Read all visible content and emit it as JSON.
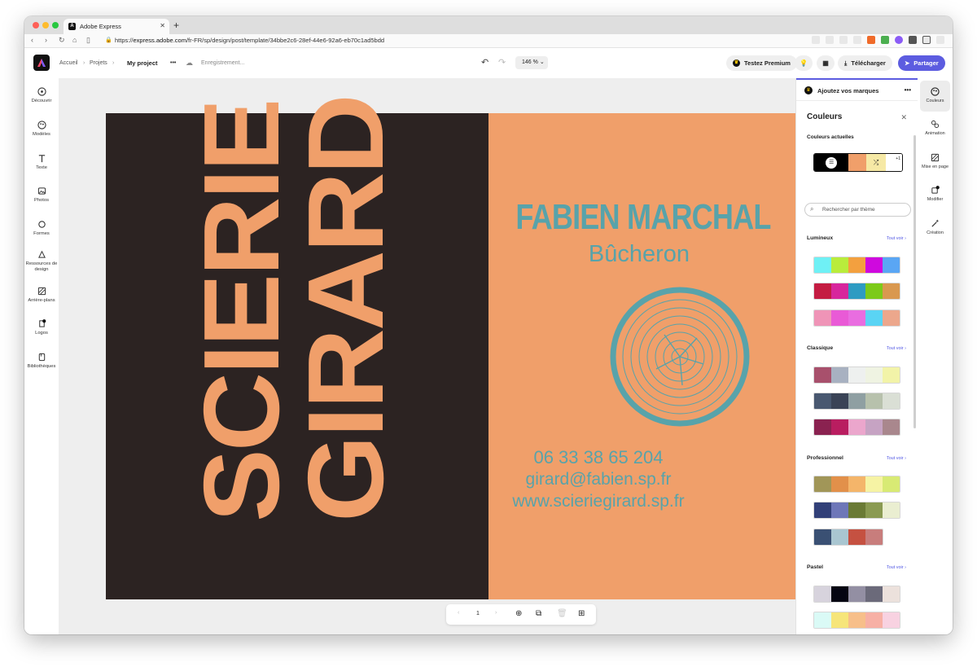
{
  "browser": {
    "tab_title": "Adobe Express",
    "url_prefix": "https://",
    "url_host": "express.adobe.com",
    "url_path": "/fr-FR/sp/design/post/template/34bbe2c6-28ef-44e6-92a6-eb70c1ad5bdd"
  },
  "header": {
    "breadcrumb_home": "Accueil",
    "breadcrumb_projects": "Projets",
    "project_name": "My project",
    "more": "•••",
    "save_status": "Enregistrement...",
    "zoom": "146 %",
    "premium_label": "Testez Premium",
    "download_label": "Télécharger",
    "share_label": "Partager"
  },
  "left_rail": [
    {
      "label": "Découvrir",
      "icon": "compass-icon"
    },
    {
      "label": "Modèles",
      "icon": "templates-icon"
    },
    {
      "label": "Texte",
      "icon": "text-icon"
    },
    {
      "label": "Photos",
      "icon": "photo-icon"
    },
    {
      "label": "Formes",
      "icon": "shapes-icon"
    },
    {
      "label": "Ressources de design",
      "icon": "design-assets-icon"
    },
    {
      "label": "Arrière-plans",
      "icon": "background-icon"
    },
    {
      "label": "Logos",
      "icon": "logo-icon"
    },
    {
      "label": "Bibliothèques",
      "icon": "library-icon"
    }
  ],
  "card": {
    "brand_line1": "SCIERIE",
    "brand_line2": "GIRARD",
    "name": "FABIEN MARCHAL",
    "job": "Bûcheron",
    "phone": "06 33 38 65 204",
    "email": "girard@fabien.sp.fr",
    "website": "www.scieriegirard.sp.fr",
    "colors": {
      "dark": "#2c2322",
      "orange": "#f09f6a",
      "teal": "#58a3aa"
    }
  },
  "pager": {
    "page": "1"
  },
  "panel": {
    "brand_header": "Ajoutez vos marques",
    "title": "Couleurs",
    "current_label": "Couleurs actuelles",
    "current_colors": [
      "#000000",
      "#f09f6a",
      "#f6e9a5"
    ],
    "current_extra": "+1",
    "search_placeholder": "Rechercher par thème",
    "see_all": "Tout voir",
    "themes": [
      {
        "name": "Lumineux",
        "palettes": [
          [
            "#6ff0f5",
            "#b9ec3c",
            "#f3a03f",
            "#cf09de",
            "#5aa6f4"
          ],
          [
            "#c41c42",
            "#d7259c",
            "#2e9bc2",
            "#7cca19",
            "#d9984f"
          ],
          [
            "#ef94b7",
            "#e95ad6",
            "#e96de0",
            "#5ad4f4",
            "#eca78c"
          ]
        ]
      },
      {
        "name": "Classique",
        "palettes": [
          [
            "#a8506c",
            "#a8b1c1",
            "#eef0ef",
            "#eff3e2",
            "#f2f3a8"
          ],
          [
            "#495870",
            "#3a4356",
            "#8f9fa2",
            "#b7c1ac",
            "#dadfd5"
          ],
          [
            "#8a2250",
            "#b91d60",
            "#eba6cc",
            "#c6a3c3",
            "#a9878d"
          ]
        ]
      },
      {
        "name": "Professionnel",
        "palettes": [
          [
            "#a19658",
            "#e2904a",
            "#f4b56a",
            "#f6f3a4",
            "#d8ea74"
          ],
          [
            "#324078",
            "#6e77b8",
            "#6a7a35",
            "#8a9a52",
            "#eaeed1"
          ],
          [
            "#3a5073",
            "#a9c6d1",
            "#c55141",
            "#c87d7c"
          ]
        ]
      },
      {
        "name": "Pastel",
        "palettes": [
          [
            "#d7d3dd",
            "#050512",
            "#938fa3",
            "#6b6a7a",
            "#ece1dc"
          ],
          [
            "#dafaf6",
            "#f6e57a",
            "#f7bf8a",
            "#f7b0a5",
            "#f8d2e1"
          ]
        ]
      }
    ]
  },
  "right_rail": [
    {
      "label": "Couleurs",
      "icon": "palette-icon"
    },
    {
      "label": "Animation",
      "icon": "animation-icon"
    },
    {
      "label": "Mise en page",
      "icon": "layout-icon"
    },
    {
      "label": "Modifier",
      "icon": "edit-icon"
    },
    {
      "label": "Création",
      "icon": "magic-wand-icon"
    }
  ]
}
